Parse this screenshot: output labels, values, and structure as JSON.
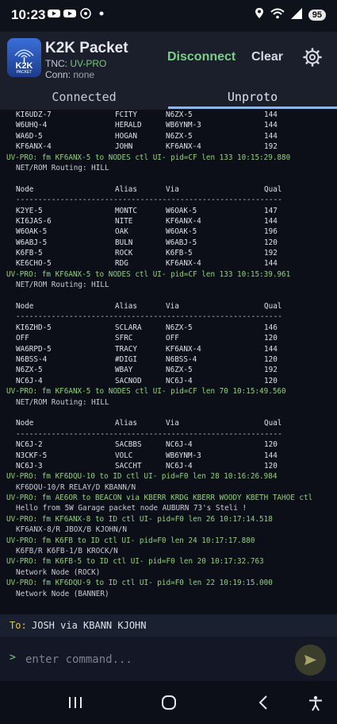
{
  "status_bar": {
    "time": "10:23",
    "battery": "95"
  },
  "app": {
    "title": "K2K Packet",
    "logo_text": "K2K",
    "logo_sub": "PACKET",
    "tnc_label": "TNC:",
    "tnc_value": "UV-PRO",
    "conn_label": "Conn:",
    "conn_value": "none",
    "disconnect_label": "Disconnect",
    "clear_label": "Clear"
  },
  "tabs": [
    {
      "label": "Connected",
      "active": false
    },
    {
      "label": "Unproto",
      "active": true
    }
  ],
  "terminal_lines": [
    {
      "t": "row",
      "c": [
        "KI6UDZ-7",
        "FCITY",
        "N6ZX-5",
        "144"
      ]
    },
    {
      "t": "row",
      "c": [
        "W6UHQ-4",
        "HERALD",
        "WB6YNM-3",
        "144"
      ]
    },
    {
      "t": "row",
      "c": [
        "WA6D-5",
        "HOGAN",
        "N6ZX-5",
        "144"
      ]
    },
    {
      "t": "row",
      "c": [
        "KF6ANX-4",
        "JOHN",
        "KF6ANX-4",
        "192"
      ]
    },
    {
      "t": "green",
      "s": "UV-PRO: fm KF6ANX-5 to NODES ctl UI- pid=CF len 133 10:15:29.880"
    },
    {
      "t": "ind",
      "s": "NET/ROM Routing: HILL"
    },
    {
      "t": "blank",
      "s": ""
    },
    {
      "t": "row",
      "c": [
        "Node",
        "Alias",
        "Via",
        "Qual"
      ]
    },
    {
      "t": "ind",
      "s": "------------------------------------------------------------"
    },
    {
      "t": "row",
      "c": [
        "K2YE-5",
        "MONTC",
        "W6OAK-5",
        "147"
      ]
    },
    {
      "t": "row",
      "c": [
        "KI6JAS-6",
        "NITE",
        "KF6ANX-4",
        "144"
      ]
    },
    {
      "t": "row",
      "c": [
        "W6OAK-5",
        "OAK",
        "W6OAK-5",
        "196"
      ]
    },
    {
      "t": "row",
      "c": [
        "W6ABJ-5",
        "BULN",
        "W6ABJ-5",
        "120"
      ]
    },
    {
      "t": "row",
      "c": [
        "K6FB-5",
        "ROCK",
        "K6FB-5",
        "192"
      ]
    },
    {
      "t": "row",
      "c": [
        "KE6CHO-5",
        "RDG",
        "KF6ANX-4",
        "144"
      ]
    },
    {
      "t": "green",
      "s": "UV-PRO: fm KF6ANX-5 to NODES ctl UI- pid=CF len 133 10:15:39.961"
    },
    {
      "t": "ind",
      "s": "NET/ROM Routing: HILL"
    },
    {
      "t": "blank",
      "s": ""
    },
    {
      "t": "row",
      "c": [
        "Node",
        "Alias",
        "Via",
        "Qual"
      ]
    },
    {
      "t": "ind",
      "s": "------------------------------------------------------------"
    },
    {
      "t": "row",
      "c": [
        "KI6ZHD-5",
        "SCLARA",
        "N6ZX-5",
        "146"
      ]
    },
    {
      "t": "row",
      "c": [
        "OFF",
        "SFRC",
        "OFF",
        "120"
      ]
    },
    {
      "t": "row",
      "c": [
        "WA6RPD-5",
        "TRACY",
        "KF6ANX-4",
        "144"
      ]
    },
    {
      "t": "row",
      "c": [
        "N6BSS-4",
        "#DIGI",
        "N6BSS-4",
        "120"
      ]
    },
    {
      "t": "row",
      "c": [
        "N6ZX-5",
        "WBAY",
        "N6ZX-5",
        "192"
      ]
    },
    {
      "t": "row",
      "c": [
        "NC6J-4",
        "SACNOD",
        "NC6J-4",
        "120"
      ]
    },
    {
      "t": "green",
      "s": "UV-PRO: fm KF6ANX-5 to NODES ctl UI- pid=CF len 70 10:15:49.560"
    },
    {
      "t": "ind",
      "s": "NET/ROM Routing: HILL"
    },
    {
      "t": "blank",
      "s": ""
    },
    {
      "t": "row",
      "c": [
        "Node",
        "Alias",
        "Via",
        "Qual"
      ]
    },
    {
      "t": "ind",
      "s": "------------------------------------------------------------"
    },
    {
      "t": "row",
      "c": [
        "NC6J-2",
        "SACBBS",
        "NC6J-4",
        "120"
      ]
    },
    {
      "t": "row",
      "c": [
        "N3CKF-5",
        "VOLC",
        "WB6YNM-3",
        "144"
      ]
    },
    {
      "t": "row",
      "c": [
        "NC6J-3",
        "SACCHT",
        "NC6J-4",
        "120"
      ]
    },
    {
      "t": "green",
      "s": "UV-PRO: fm KF6DQU-10 to ID ctl UI- pid=F0 len 28 10:16:26.984"
    },
    {
      "t": "ind",
      "s": "KF6DQU-10/R RELAY/D KBANN/N"
    },
    {
      "t": "green",
      "s": "UV-PRO: fm AE6OR to BEACON via KBERR KRDG KBERR WOODY KBETH TAHOE ctl"
    },
    {
      "t": "ind",
      "s": "Hello from 5W Garage packet node AUBURN 73's Steli !"
    },
    {
      "t": "green",
      "s": "UV-PRO: fm KF6ANX-8 to ID ctl UI- pid=F0 len 26 10:17:14.518"
    },
    {
      "t": "ind",
      "s": "KF6ANX-8/R JBOX/B KJOHN/N"
    },
    {
      "t": "green",
      "s": "UV-PRO: fm K6FB to ID ctl UI- pid=F0 len 24 10:17:17.880"
    },
    {
      "t": "ind",
      "s": "K6FB/R K6FB-1/B KROCK/N"
    },
    {
      "t": "green",
      "s": "UV-PRO: fm K6FB-5 to ID ctl UI- pid=F0 len 20 10:17:32.763"
    },
    {
      "t": "ind",
      "s": "Network Node (ROCK)"
    },
    {
      "t": "green",
      "s": "UV-PRO: fm KF6DQU-9 to ID ctl UI- pid=F0 len 22 10:19:15.000"
    },
    {
      "t": "ind",
      "s": "Network Node (BANNER)"
    }
  ],
  "to_bar": {
    "label": "To:",
    "value": "JOSH via KBANN KJOHN"
  },
  "command": {
    "prompt": ">",
    "placeholder": "enter command...",
    "value": ""
  },
  "icons": {
    "gear": "gear-icon",
    "send": "send-icon",
    "nav_recents": "recents-icon",
    "nav_home": "home-icon",
    "nav_back": "back-icon",
    "nav_accessibility": "accessibility-icon"
  },
  "colors": {
    "accent_green": "#7bd089",
    "packet_header": "#8fd27a",
    "to_label": "#e3c35b",
    "tab_indicator": "#8fb6e8"
  }
}
